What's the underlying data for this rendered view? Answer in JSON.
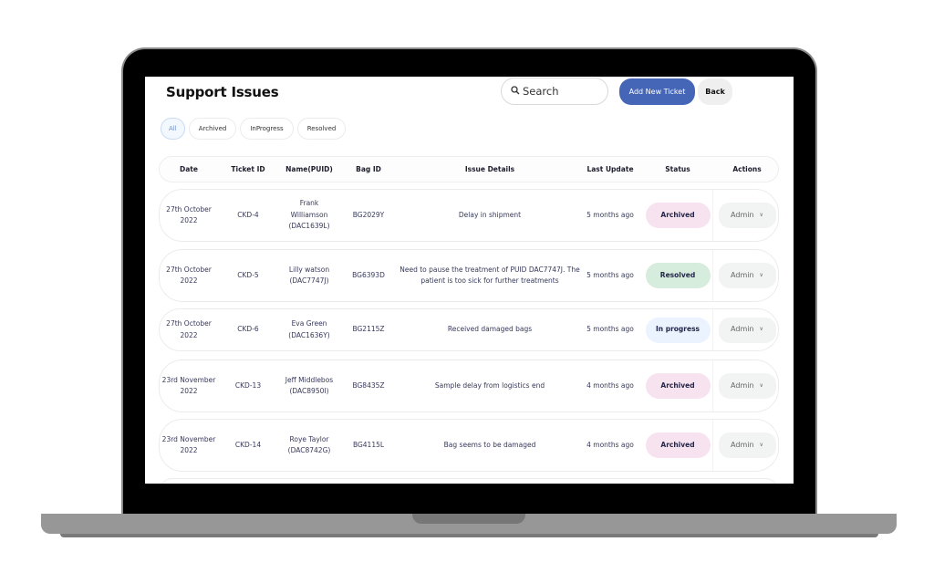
{
  "page": {
    "title": "Support Issues",
    "search": {
      "placeholder": "Search",
      "icon": "search-icon"
    },
    "add_button": "Add New Ticket",
    "back_button": "Back",
    "colors": {
      "primary": "#4565b7",
      "archived_bg": "#f7e3ef",
      "resolved_bg": "#d6ecdd",
      "inprogress_bg": "#eaf3fe"
    }
  },
  "filters": [
    {
      "label": "All",
      "active": true
    },
    {
      "label": "Archived",
      "active": false
    },
    {
      "label": "InProgress",
      "active": false
    },
    {
      "label": "Resolved",
      "active": false
    }
  ],
  "table": {
    "headers": {
      "date": "Date",
      "ticket_id": "Ticket ID",
      "name": "Name(PUID)",
      "bag_id": "Bag ID",
      "issue": "Issue Details",
      "last_update": "Last Update",
      "status": "Status",
      "actions": "Actions"
    },
    "rows": [
      {
        "date": "27th October 2022",
        "ticket_id": "CKD-4",
        "name": "Frank Williamson (DAC1639L)",
        "bag_id": "BG2029Y",
        "issue": "Delay in shipment",
        "last_update": "5 months ago",
        "status": "Archived",
        "action": "Admin"
      },
      {
        "date": "27th October 2022",
        "ticket_id": "CKD-5",
        "name": "Lilly watson (DAC7747J)",
        "bag_id": "BG6393D",
        "issue": "Need to pause the treatment of PUID DAC7747J. The patient is too sick for further treatments",
        "last_update": "5 months ago",
        "status": "Resolved",
        "action": "Admin"
      },
      {
        "date": "27th October 2022",
        "ticket_id": "CKD-6",
        "name": "Eva Green (DAC1636Y)",
        "bag_id": "BG2115Z",
        "issue": "Received damaged bags",
        "last_update": "5 months ago",
        "status": "In progress",
        "action": "Admin"
      },
      {
        "date": "23rd November 2022",
        "ticket_id": "CKD-13",
        "name": "Jeff Middlebos (DAC8950I)",
        "bag_id": "BG8435Z",
        "issue": "Sample delay from logistics end",
        "last_update": "4 months ago",
        "status": "Archived",
        "action": "Admin"
      },
      {
        "date": "23rd November 2022",
        "ticket_id": "CKD-14",
        "name": "Roye Taylor (DAC8742G)",
        "bag_id": "BG4115L",
        "issue": "Bag seems to be damaged",
        "last_update": "4 months ago",
        "status": "Archived",
        "action": "Admin"
      }
    ]
  }
}
